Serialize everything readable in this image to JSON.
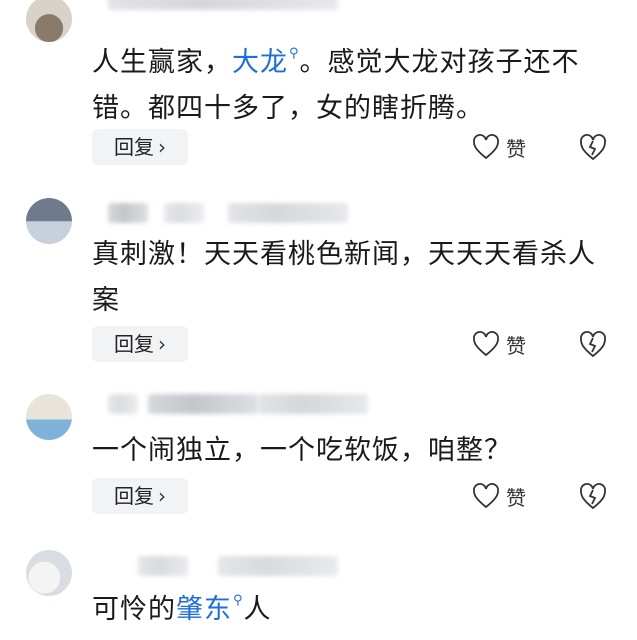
{
  "comments": [
    {
      "text_before": "人生赢家，",
      "highlight": "大龙",
      "text_after": "。感觉大龙对孩子还不错。都四十多了，女的瞎折腾。",
      "reply_label": "回复",
      "like_label": "赞"
    },
    {
      "text": "真刺激！天天看桃色新闻，天天天看杀人案",
      "reply_label": "回复",
      "like_label": "赞"
    },
    {
      "text": "一个闹独立，一个吃软饭，咱整？",
      "reply_label": "回复",
      "like_label": "赞"
    },
    {
      "text_before": "可怜的",
      "highlight": "肇东",
      "text_after": "人"
    }
  ],
  "icons": {
    "search_marker": "search-icon",
    "like": "heart-outline-icon",
    "dislike": "broken-heart-icon",
    "chevron": "chevron-right-icon"
  },
  "colors": {
    "highlight": "#1e6ed8",
    "reply_bg": "#f2f3f5"
  }
}
